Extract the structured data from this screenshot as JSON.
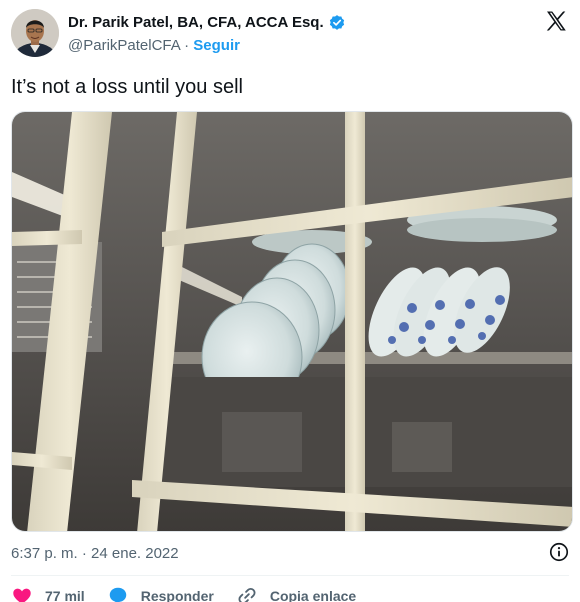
{
  "author": {
    "name": "Dr. Parik Patel, BA, CFA, ACCA Esq.",
    "handle": "@ParikPatelCFA",
    "separator": "·",
    "follow_label": "Seguir"
  },
  "tweet": {
    "text": "It’s not a loss until you sell",
    "timestamp": "6:37 p. m. · 24 ene. 2022"
  },
  "actions": {
    "likes_count": "77 mil",
    "reply_label": "Responder",
    "copy_link_label": "Copia enlace"
  },
  "icons": {
    "verified": "verified-badge-icon",
    "logo": "x-logo-icon",
    "info": "info-icon",
    "like": "heart-icon",
    "reply": "reply-bubble-icon",
    "copy_link": "link-icon"
  },
  "colors": {
    "accent": "#1d9bf0",
    "like": "#f91880",
    "secondary_text": "#536471",
    "primary_text": "#0f1419"
  }
}
